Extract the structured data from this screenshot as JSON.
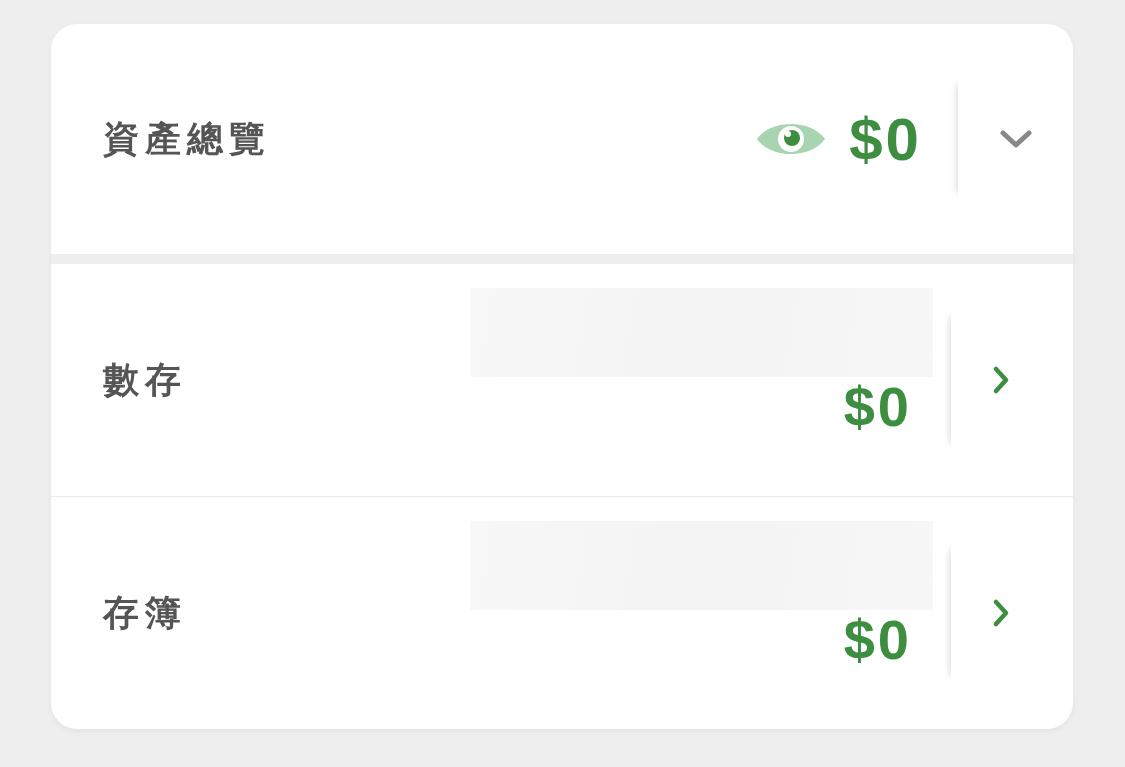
{
  "overview": {
    "title": "資產總覽",
    "amount": "$0",
    "expanded": false
  },
  "accounts": [
    {
      "label": "數存",
      "amount": "$0"
    },
    {
      "label": "存簿",
      "amount": "$0"
    }
  ]
}
